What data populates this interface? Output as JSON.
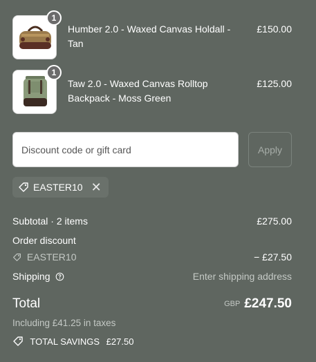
{
  "items": [
    {
      "title": "Humber 2.0 - Waxed Canvas Holdall - Tan",
      "price": "£150.00",
      "qty": "1",
      "icon": "holdall-bag-icon"
    },
    {
      "title": "Taw 2.0 - Waxed Canvas Rolltop Backpack - Moss Green",
      "price": "£125.00",
      "qty": "1",
      "icon": "backpack-icon"
    }
  ],
  "discount": {
    "placeholder": "Discount code or gift card",
    "apply_label": "Apply",
    "applied_code": "EASTER10"
  },
  "summary": {
    "subtotal_label": "Subtotal · 2 items",
    "subtotal_value": "£275.00",
    "order_discount_label": "Order discount",
    "discount_code": "EASTER10",
    "discount_value": "− £27.50",
    "shipping_label": "Shipping",
    "shipping_value": "Enter shipping address",
    "total_label": "Total",
    "currency": "GBP",
    "total_value": "£247.50",
    "taxes_text": "Including £41.25 in taxes",
    "savings_label": "TOTAL SAVINGS",
    "savings_value": "£27.50"
  },
  "colors": {
    "background": "#5f6660",
    "text": "#ffffff",
    "muted": "#c4c9c5"
  }
}
